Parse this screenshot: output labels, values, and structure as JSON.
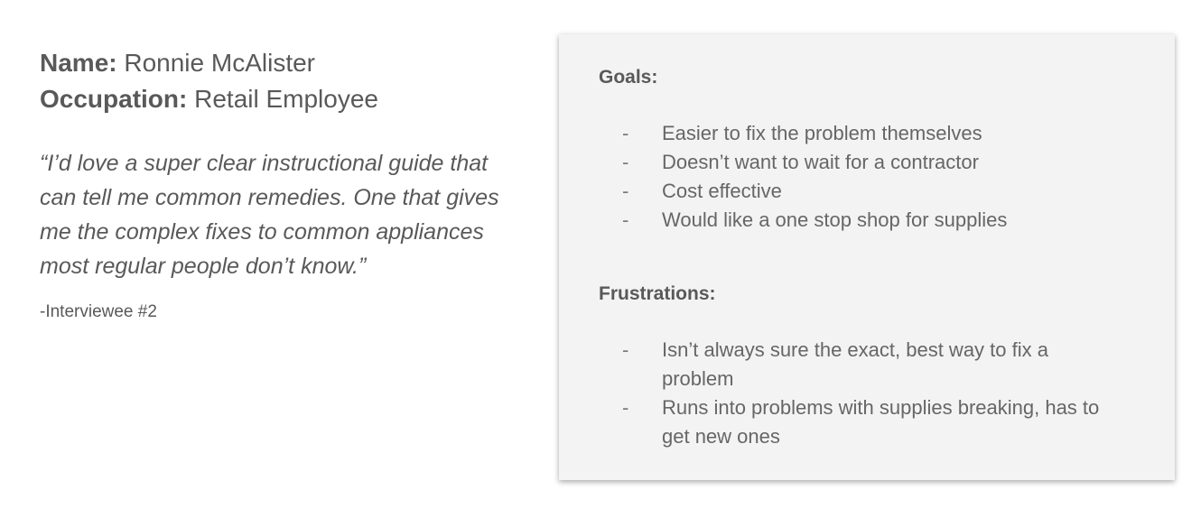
{
  "persona": {
    "name_label": "Name:",
    "name_value": " Ronnie McAlister",
    "occupation_label": "Occupation:",
    "occupation_value": " Retail Employee",
    "quote": "“I’d love a super clear instructional guide that can tell me common remedies. One that gives me the complex fixes to common appliances most regular people don’t know.”",
    "attribution": "-Interviewee #2"
  },
  "card": {
    "goals_title": "Goals:",
    "goals": [
      "Easier to fix the problem themselves",
      "Doesn’t want to wait for a contractor",
      "Cost effective",
      "Would like a one stop shop for supplies"
    ],
    "frustrations_title": "Frustrations:",
    "frustrations": [
      "Isn’t always sure the exact, best way to fix a problem",
      "Runs into problems with supplies breaking, has to get new ones"
    ],
    "bullet": "-"
  }
}
